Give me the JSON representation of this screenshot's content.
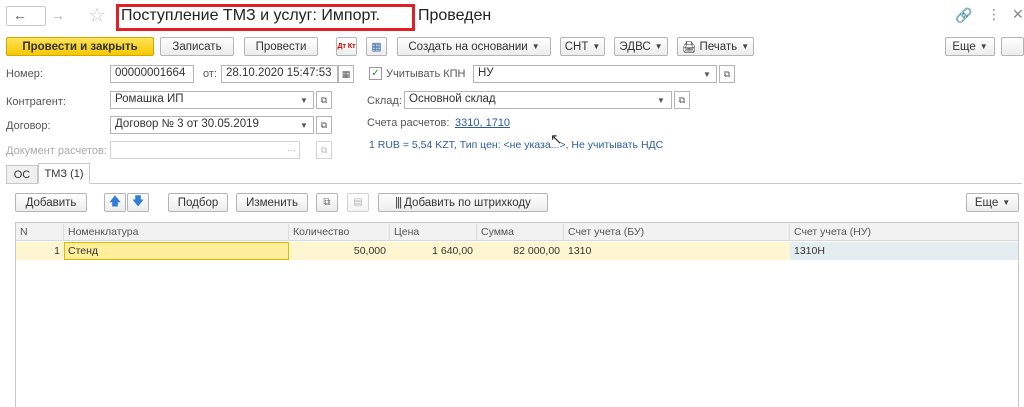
{
  "header": {
    "title_boxed": "Поступление ТМЗ и услуг: Импорт.",
    "title_rest": "Проведен"
  },
  "toolbar": {
    "post_close": "Провести и закрыть",
    "save": "Записать",
    "post": "Провести",
    "create_based": "Создать на основании",
    "snt": "СНТ",
    "edvs": "ЭДВС",
    "print": "Печать",
    "more": "Еще",
    "dtkt": "Дт Кт"
  },
  "form": {
    "number_label": "Номер:",
    "number_value": "00000001664",
    "date_label": "от:",
    "date_value": "28.10.2020 15:47:53",
    "kpn_label": "Учитывать КПН",
    "kpn_value": "НУ",
    "counterparty_label": "Контрагент:",
    "counterparty_value": "Ромашка ИП",
    "warehouse_label": "Склад:",
    "warehouse_value": "Основной склад",
    "contract_label": "Договор:",
    "contract_value": "Договор № 3 от 30.05.2019",
    "accounts_label": "Счета расчетов:",
    "accounts_link": "3310, 1710",
    "settlement_doc_label": "Документ расчетов:",
    "settlement_doc_dots": "...",
    "currency_note": "1 RUB = 5,54 KZT, Тип цен: <не указа...>, Не учитывать НДС"
  },
  "tabs": [
    {
      "label": "ОС"
    },
    {
      "label": "ТМЗ (1)"
    }
  ],
  "table_toolbar": {
    "add": "Добавить",
    "select": "Подбор",
    "change": "Изменить",
    "barcode": "Добавить по штрихкоду",
    "more": "Еще"
  },
  "table": {
    "columns": [
      "N",
      "Номенклатура",
      "Количество",
      "Цена",
      "Сумма",
      "Счет учета (БУ)",
      "Счет учета (НУ)"
    ],
    "rows": [
      {
        "n": "1",
        "item": "Стенд",
        "qty": "50,000",
        "price": "1 640,00",
        "sum": "82 000,00",
        "acc_bu": "1310",
        "acc_nu": "1310Н"
      }
    ]
  },
  "colors": {
    "primary_button": "#f5c800",
    "highlight_box": "#e31e24",
    "selected_row": "#fdf6d0",
    "link": "#2d5c9e"
  }
}
